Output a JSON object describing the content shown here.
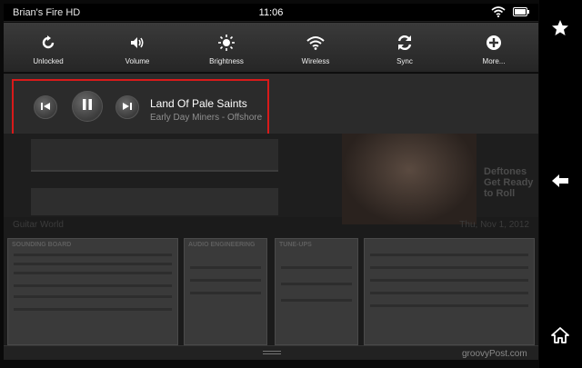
{
  "status_bar": {
    "device_name": "Brian's Fire HD",
    "time": "11:06",
    "icons": [
      "wifi-icon",
      "battery-icon"
    ]
  },
  "quick_settings": {
    "items": [
      {
        "label": "Unlocked",
        "icon": "rotation-lock-icon"
      },
      {
        "label": "Volume",
        "icon": "volume-icon"
      },
      {
        "label": "Brightness",
        "icon": "brightness-icon"
      },
      {
        "label": "Wireless",
        "icon": "wifi-icon"
      },
      {
        "label": "Sync",
        "icon": "sync-icon"
      },
      {
        "label": "More...",
        "icon": "plus-icon"
      }
    ]
  },
  "media": {
    "title": "Land Of Pale Saints",
    "subtitle": "Early Day Miners - Offshore",
    "highlight_color": "#d81a1a"
  },
  "background": {
    "shelf_label": "Guitar World",
    "shelf_date": "Thu, Nov 1, 2012",
    "headline": "Deftones Get Ready to Roll",
    "pages": [
      {
        "header": "SOUNDING BOARD"
      },
      {
        "header": "AUDIO ENGINEERING"
      },
      {
        "header": "TUNE-UPS"
      },
      {
        "header": ""
      }
    ]
  },
  "nav": {
    "icons": [
      "star-icon",
      "back-arrow-icon",
      "home-icon"
    ]
  },
  "watermark": "groovyPost.com"
}
